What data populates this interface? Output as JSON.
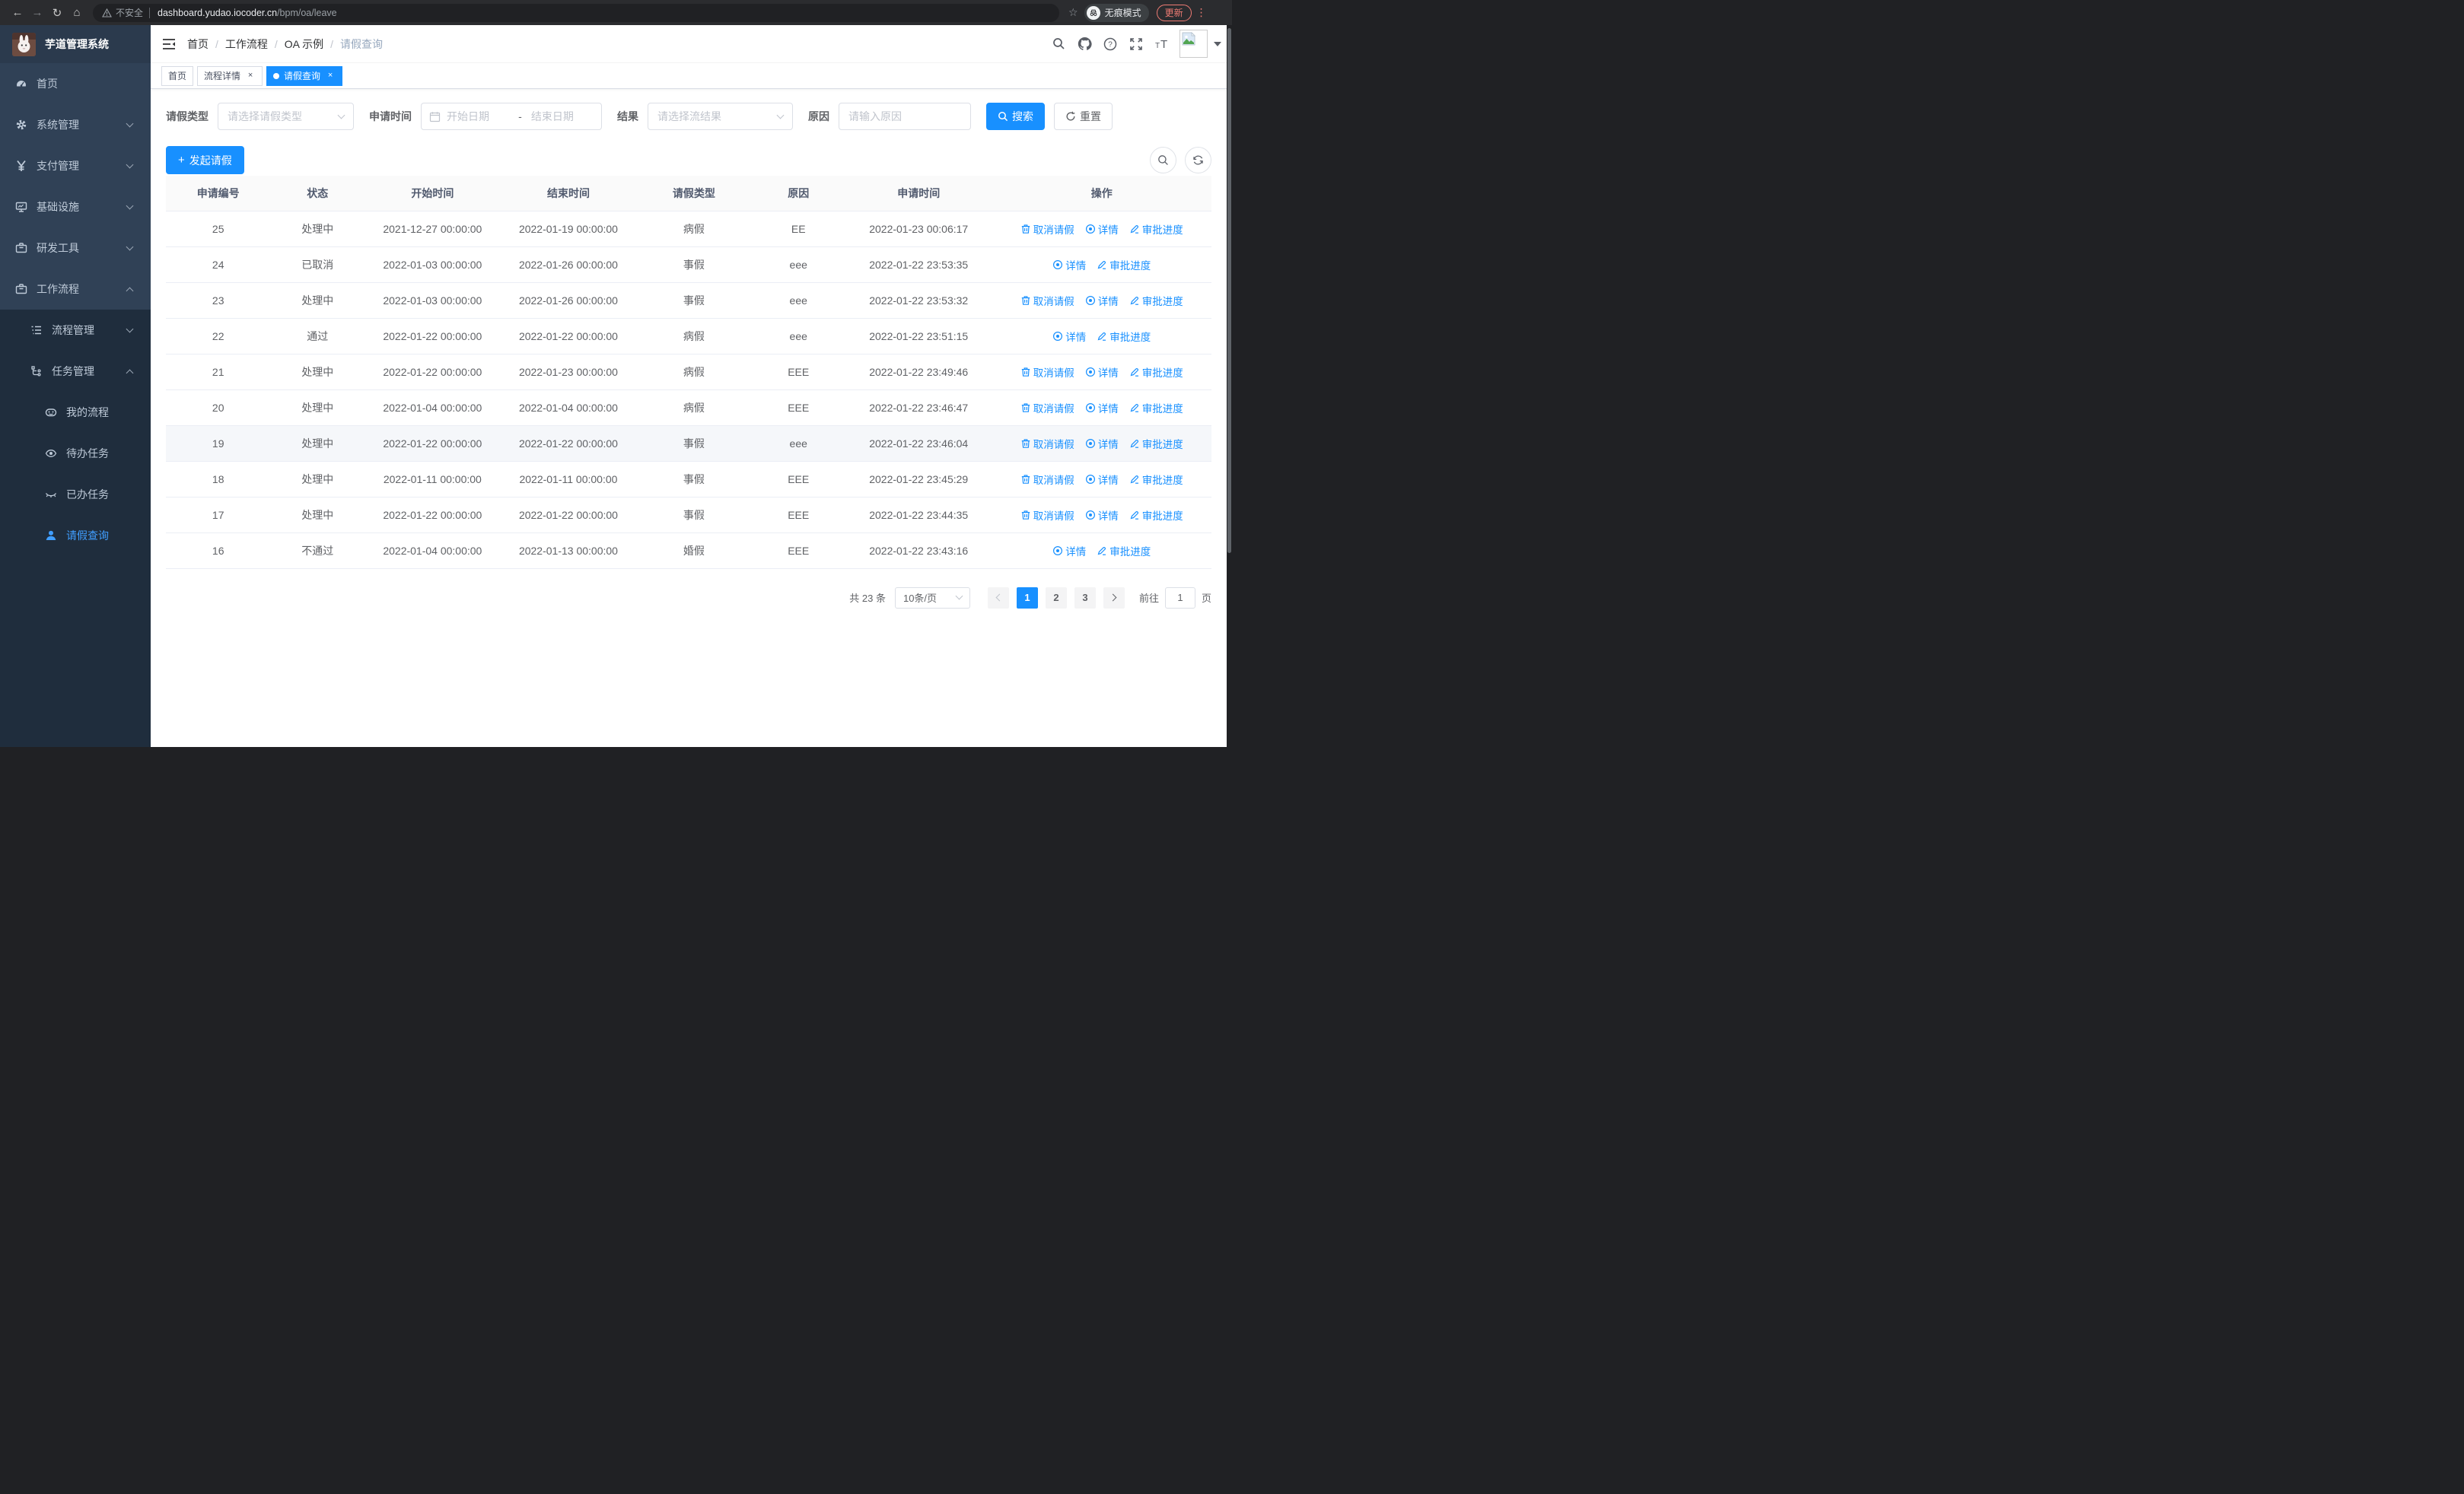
{
  "colors": {
    "accent": "#1890ff",
    "sidebar_bg": "#304156",
    "submenu_bg": "#1f2d3d",
    "active_menu": "#409eff",
    "update_accent": "#ee7b73"
  },
  "browser": {
    "security_warning": "不安全",
    "url_host": "dashboard.yudao.iocoder.cn",
    "url_path": "/bpm/oa/leave",
    "incognito_label": "无痕模式",
    "update_label": "更新",
    "menu_dots": "⋮",
    "back": "←",
    "forward": "→",
    "reload": "↻",
    "home": "⌂",
    "star": "☆"
  },
  "sidebar": {
    "title": "芋道管理系统",
    "menu": [
      {
        "label": "首页",
        "icon": "dashboard-icon",
        "level": 1,
        "arrow": "none",
        "active": false
      },
      {
        "label": "系统管理",
        "icon": "gear-icon",
        "level": 1,
        "arrow": "down",
        "active": false
      },
      {
        "label": "支付管理",
        "icon": "yen-icon",
        "level": 1,
        "arrow": "down",
        "active": false
      },
      {
        "label": "基础设施",
        "icon": "infra-icon",
        "level": 1,
        "arrow": "down",
        "active": false
      },
      {
        "label": "研发工具",
        "icon": "tools-icon",
        "level": 1,
        "arrow": "down",
        "active": false
      }
    ],
    "workflow": {
      "label": "工作流程",
      "icon": "workflow-icon",
      "level": 1,
      "arrow": "up",
      "active": false
    },
    "submenu": [
      {
        "label": "流程管理",
        "icon": "process-icon",
        "level": 2,
        "arrow": "down",
        "active": false
      },
      {
        "label": "任务管理",
        "icon": "task-icon",
        "level": 2,
        "arrow": "up",
        "active": false
      },
      {
        "label": "我的流程",
        "icon": "robot-icon",
        "level": 3,
        "arrow": "none",
        "active": false
      },
      {
        "label": "待办任务",
        "icon": "eye-open-icon",
        "level": 3,
        "arrow": "none",
        "active": false
      },
      {
        "label": "已办任务",
        "icon": "eye-closed-icon",
        "level": 3,
        "arrow": "none",
        "active": false
      },
      {
        "label": "请假查询",
        "icon": "user-icon",
        "level": 3,
        "arrow": "none",
        "active": true
      }
    ]
  },
  "header": {
    "crumb_sep": "/",
    "breadcrumb": [
      {
        "label": "首页"
      },
      {
        "label": "工作流程"
      },
      {
        "label": "OA 示例"
      },
      {
        "label": "请假查询"
      }
    ]
  },
  "tags": [
    {
      "label": "首页",
      "active": false,
      "closable": false
    },
    {
      "label": "流程详情",
      "active": false,
      "closable": true,
      "close": "×"
    },
    {
      "label": "请假查询",
      "active": true,
      "closable": true,
      "close": "×"
    }
  ],
  "filters": {
    "leave_type_label": "请假类型",
    "leave_type_placeholder": "请选择请假类型",
    "apply_time_label": "申请时间",
    "date_start_placeholder": "开始日期",
    "date_separator": "-",
    "date_end_placeholder": "结束日期",
    "result_label": "结果",
    "result_placeholder": "请选择流结果",
    "reason_label": "原因",
    "reason_placeholder": "请输入原因",
    "search_label": "搜索",
    "reset_label": "重置"
  },
  "toolbar": {
    "create_label": "发起请假",
    "plus": "+"
  },
  "table": {
    "headers": [
      "申请编号",
      "状态",
      "开始时间",
      "结束时间",
      "请假类型",
      "原因",
      "申请时间",
      "操作"
    ],
    "rows": [
      {
        "id": "25",
        "status": "处理中",
        "start": "2021-12-27 00:00:00",
        "end": "2022-01-19 00:00:00",
        "type": "病假",
        "reason": "EE",
        "apply_time": "2022-01-23 00:06:17",
        "hover": false,
        "actions": [
          {
            "type": "cancel",
            "label": "取消请假"
          },
          {
            "type": "detail",
            "label": "详情"
          },
          {
            "type": "progress",
            "label": "审批进度"
          }
        ]
      },
      {
        "id": "24",
        "status": "已取消",
        "start": "2022-01-03 00:00:00",
        "end": "2022-01-26 00:00:00",
        "type": "事假",
        "reason": "eee",
        "apply_time": "2022-01-22 23:53:35",
        "hover": false,
        "actions": [
          {
            "type": "detail",
            "label": "详情"
          },
          {
            "type": "progress",
            "label": "审批进度"
          }
        ]
      },
      {
        "id": "23",
        "status": "处理中",
        "start": "2022-01-03 00:00:00",
        "end": "2022-01-26 00:00:00",
        "type": "事假",
        "reason": "eee",
        "apply_time": "2022-01-22 23:53:32",
        "hover": false,
        "actions": [
          {
            "type": "cancel",
            "label": "取消请假"
          },
          {
            "type": "detail",
            "label": "详情"
          },
          {
            "type": "progress",
            "label": "审批进度"
          }
        ]
      },
      {
        "id": "22",
        "status": "通过",
        "start": "2022-01-22 00:00:00",
        "end": "2022-01-22 00:00:00",
        "type": "病假",
        "reason": "eee",
        "apply_time": "2022-01-22 23:51:15",
        "hover": false,
        "actions": [
          {
            "type": "detail",
            "label": "详情"
          },
          {
            "type": "progress",
            "label": "审批进度"
          }
        ]
      },
      {
        "id": "21",
        "status": "处理中",
        "start": "2022-01-22 00:00:00",
        "end": "2022-01-23 00:00:00",
        "type": "病假",
        "reason": "EEE",
        "apply_time": "2022-01-22 23:49:46",
        "hover": false,
        "actions": [
          {
            "type": "cancel",
            "label": "取消请假"
          },
          {
            "type": "detail",
            "label": "详情"
          },
          {
            "type": "progress",
            "label": "审批进度"
          }
        ]
      },
      {
        "id": "20",
        "status": "处理中",
        "start": "2022-01-04 00:00:00",
        "end": "2022-01-04 00:00:00",
        "type": "病假",
        "reason": "EEE",
        "apply_time": "2022-01-22 23:46:47",
        "hover": false,
        "actions": [
          {
            "type": "cancel",
            "label": "取消请假"
          },
          {
            "type": "detail",
            "label": "详情"
          },
          {
            "type": "progress",
            "label": "审批进度"
          }
        ]
      },
      {
        "id": "19",
        "status": "处理中",
        "start": "2022-01-22 00:00:00",
        "end": "2022-01-22 00:00:00",
        "type": "事假",
        "reason": "eee",
        "apply_time": "2022-01-22 23:46:04",
        "hover": true,
        "actions": [
          {
            "type": "cancel",
            "label": "取消请假"
          },
          {
            "type": "detail",
            "label": "详情"
          },
          {
            "type": "progress",
            "label": "审批进度"
          }
        ]
      },
      {
        "id": "18",
        "status": "处理中",
        "start": "2022-01-11 00:00:00",
        "end": "2022-01-11 00:00:00",
        "type": "事假",
        "reason": "EEE",
        "apply_time": "2022-01-22 23:45:29",
        "hover": false,
        "actions": [
          {
            "type": "cancel",
            "label": "取消请假"
          },
          {
            "type": "detail",
            "label": "详情"
          },
          {
            "type": "progress",
            "label": "审批进度"
          }
        ]
      },
      {
        "id": "17",
        "status": "处理中",
        "start": "2022-01-22 00:00:00",
        "end": "2022-01-22 00:00:00",
        "type": "事假",
        "reason": "EEE",
        "apply_time": "2022-01-22 23:44:35",
        "hover": false,
        "actions": [
          {
            "type": "cancel",
            "label": "取消请假"
          },
          {
            "type": "detail",
            "label": "详情"
          },
          {
            "type": "progress",
            "label": "审批进度"
          }
        ]
      },
      {
        "id": "16",
        "status": "不通过",
        "start": "2022-01-04 00:00:00",
        "end": "2022-01-13 00:00:00",
        "type": "婚假",
        "reason": "EEE",
        "apply_time": "2022-01-22 23:43:16",
        "hover": false,
        "actions": [
          {
            "type": "detail",
            "label": "详情"
          },
          {
            "type": "progress",
            "label": "审批进度"
          }
        ]
      }
    ]
  },
  "pagination": {
    "total": "共 23 条",
    "page_size": "10条/页",
    "pages": [
      {
        "num": "1",
        "active": true
      },
      {
        "num": "2",
        "active": false
      },
      {
        "num": "3",
        "active": false
      }
    ],
    "goto_label": "前往",
    "goto_value": "1",
    "goto_suffix": "页"
  }
}
